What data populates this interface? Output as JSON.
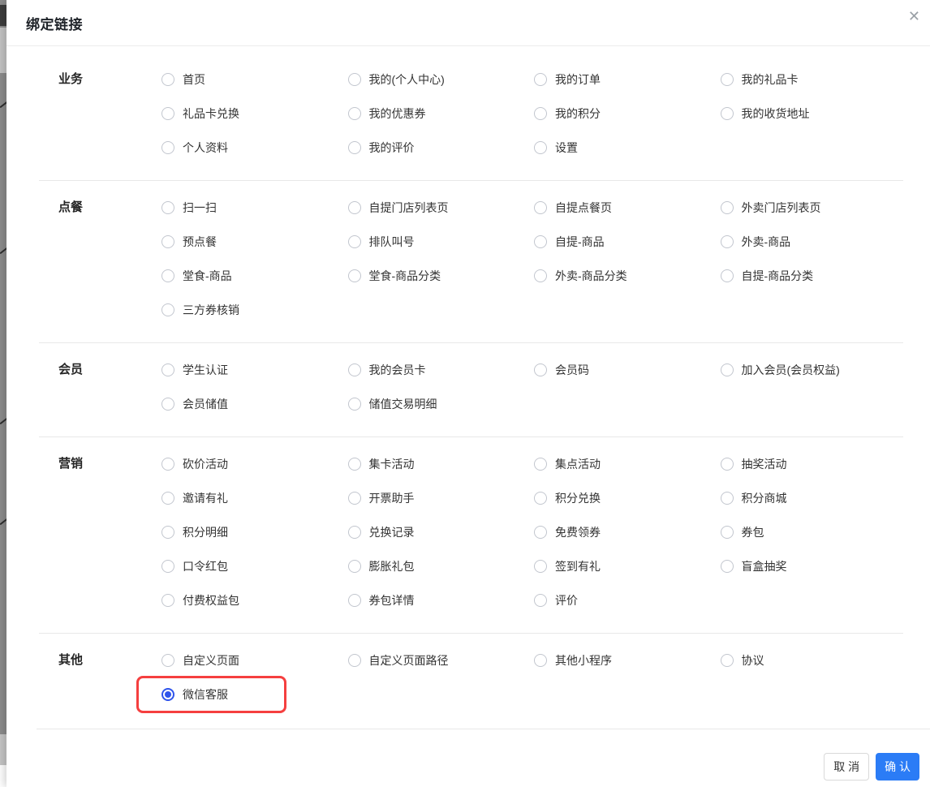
{
  "modal": {
    "title": "绑定链接",
    "close_icon": "✕"
  },
  "sections": [
    {
      "label": "业务",
      "items": [
        {
          "label": "首页"
        },
        {
          "label": "我的(个人中心)"
        },
        {
          "label": "我的订单"
        },
        {
          "label": "我的礼品卡"
        },
        {
          "label": "礼品卡兑换"
        },
        {
          "label": "我的优惠券"
        },
        {
          "label": "我的积分"
        },
        {
          "label": "我的收货地址"
        },
        {
          "label": "个人资料"
        },
        {
          "label": "我的评价"
        },
        {
          "label": "设置"
        }
      ]
    },
    {
      "label": "点餐",
      "items": [
        {
          "label": "扫一扫"
        },
        {
          "label": "自提门店列表页"
        },
        {
          "label": "自提点餐页"
        },
        {
          "label": "外卖门店列表页"
        },
        {
          "label": "预点餐"
        },
        {
          "label": "排队叫号"
        },
        {
          "label": "自提-商品"
        },
        {
          "label": "外卖-商品"
        },
        {
          "label": "堂食-商品"
        },
        {
          "label": "堂食-商品分类"
        },
        {
          "label": "外卖-商品分类"
        },
        {
          "label": "自提-商品分类"
        },
        {
          "label": "三方券核销"
        }
      ]
    },
    {
      "label": "会员",
      "items": [
        {
          "label": "学生认证"
        },
        {
          "label": "我的会员卡"
        },
        {
          "label": "会员码"
        },
        {
          "label": "加入会员(会员权益)"
        },
        {
          "label": "会员储值"
        },
        {
          "label": "储值交易明细"
        }
      ]
    },
    {
      "label": "营销",
      "items": [
        {
          "label": "砍价活动"
        },
        {
          "label": "集卡活动"
        },
        {
          "label": "集点活动"
        },
        {
          "label": "抽奖活动"
        },
        {
          "label": "邀请有礼"
        },
        {
          "label": "开票助手"
        },
        {
          "label": "积分兑换"
        },
        {
          "label": "积分商城"
        },
        {
          "label": "积分明细"
        },
        {
          "label": "兑换记录"
        },
        {
          "label": "免费领券"
        },
        {
          "label": "券包"
        },
        {
          "label": "口令红包"
        },
        {
          "label": "膨胀礼包"
        },
        {
          "label": "签到有礼"
        },
        {
          "label": "盲盒抽奖"
        },
        {
          "label": "付费权益包"
        },
        {
          "label": "券包详情"
        },
        {
          "label": "评价"
        }
      ]
    },
    {
      "label": "其他",
      "items": [
        {
          "label": "自定义页面"
        },
        {
          "label": "自定义页面路径"
        },
        {
          "label": "其他小程序"
        },
        {
          "label": "协议"
        },
        {
          "label": "微信客服",
          "selected": true,
          "highlighted": true
        }
      ]
    }
  ],
  "footer": {
    "cancel_label": "取 消",
    "confirm_label": "确 认"
  },
  "colors": {
    "radio_selected": "#2f54eb",
    "highlight_border": "#f53f3f",
    "confirm_button": "#2b7cf6",
    "divider": "#e8e8e8"
  }
}
